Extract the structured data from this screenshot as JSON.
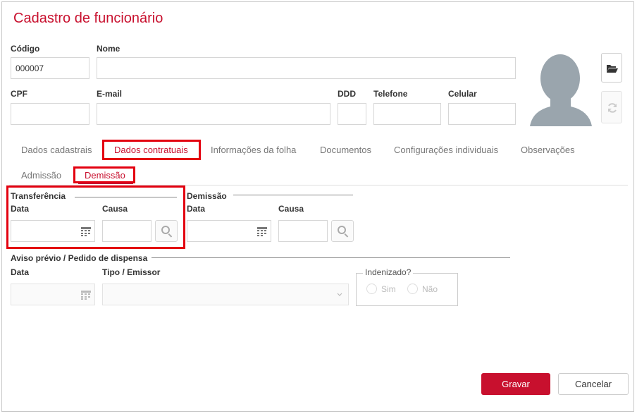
{
  "dialog": {
    "title": "Cadastro de funcionário"
  },
  "fields": {
    "codigo_label": "Código",
    "codigo_value": "000007",
    "nome_label": "Nome",
    "cpf_label": "CPF",
    "email_label": "E-mail",
    "ddd_label": "DDD",
    "telefone_label": "Telefone",
    "celular_label": "Celular"
  },
  "tabs": [
    {
      "label": "Dados cadastrais"
    },
    {
      "label": "Dados contratuais",
      "active": true
    },
    {
      "label": "Informações da folha"
    },
    {
      "label": "Documentos"
    },
    {
      "label": "Configurações individuais"
    },
    {
      "label": "Observações"
    }
  ],
  "subtabs": [
    {
      "label": "Admissão"
    },
    {
      "label": "Demissão",
      "active": true
    }
  ],
  "transferencia": {
    "legend": "Transferência",
    "data_label": "Data",
    "causa_label": "Causa"
  },
  "demissao": {
    "legend": "Demissão",
    "data_label": "Data",
    "causa_label": "Causa"
  },
  "aviso": {
    "legend": "Aviso prévio / Pedido de dispensa",
    "data_label": "Data",
    "tipo_label": "Tipo / Emissor",
    "indenizado_legend": "Indenizado?",
    "sim_label": "Sim",
    "nao_label": "Não"
  },
  "actions": {
    "gravar_label": "Gravar",
    "cancelar_label": "Cancelar"
  },
  "colors": {
    "accent": "#c8102e",
    "highlight_box": "#e3000f"
  }
}
